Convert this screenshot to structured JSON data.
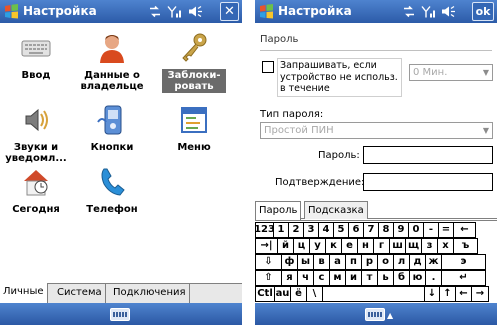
{
  "left": {
    "title": "Настройка",
    "close_label": "✕",
    "apps": [
      {
        "label": "Ввод",
        "icon": "keyboard-icon"
      },
      {
        "label": "Данные о владельце",
        "icon": "owner-icon"
      },
      {
        "label": "Заблоки-ровать",
        "icon": "lock-key-icon"
      },
      {
        "label": "Звуки и уведомл...",
        "icon": "sound-icon"
      },
      {
        "label": "Кнопки",
        "icon": "buttons-icon"
      },
      {
        "label": "Меню",
        "icon": "menu-icon"
      },
      {
        "label": "Сегодня",
        "icon": "today-icon"
      },
      {
        "label": "Телефон",
        "icon": "phone-icon"
      }
    ],
    "tabs": [
      "Личные",
      "Система",
      "Подключения"
    ]
  },
  "right": {
    "title": "Настройка",
    "ok_label": "ok",
    "section_header": "Пароль",
    "prompt_checkbox_label": "Запрашивать, если устройство не использ. в течение",
    "prompt_checked": false,
    "timeout_value": "0 Мин.",
    "password_type_label": "Тип пароля:",
    "password_type_value": "Простой ПИН",
    "password_label": "Пароль:",
    "confirm_label": "Подтверждение:",
    "password_value": "",
    "confirm_value": "",
    "tabs": [
      "Пароль",
      "Подсказка"
    ],
    "keyboard": {
      "rows": [
        [
          "123",
          "1",
          "2",
          "3",
          "4",
          "5",
          "6",
          "7",
          "8",
          "9",
          "0",
          "-",
          "=",
          "←"
        ],
        [
          "→|",
          "й",
          "ц",
          "у",
          "к",
          "е",
          "н",
          "г",
          "ш",
          "щ",
          "з",
          "х",
          "ъ"
        ],
        [
          "⇩",
          "ф",
          "ы",
          "в",
          "а",
          "п",
          "р",
          "о",
          "л",
          "д",
          "ж",
          "э"
        ],
        [
          "⇧",
          "я",
          "ч",
          "с",
          "м",
          "и",
          "т",
          "ь",
          "б",
          "ю",
          ".",
          "↵"
        ],
        [
          "Ctl",
          "au",
          "ё",
          "\\",
          " ",
          "↓",
          "↑",
          "←",
          "→"
        ]
      ]
    }
  },
  "colors": {
    "titlebar_top": "#4e83cf",
    "titlebar_bottom": "#2c5ba8",
    "selection": "#6b6b6b",
    "disabled_text": "#a8a8a8"
  }
}
